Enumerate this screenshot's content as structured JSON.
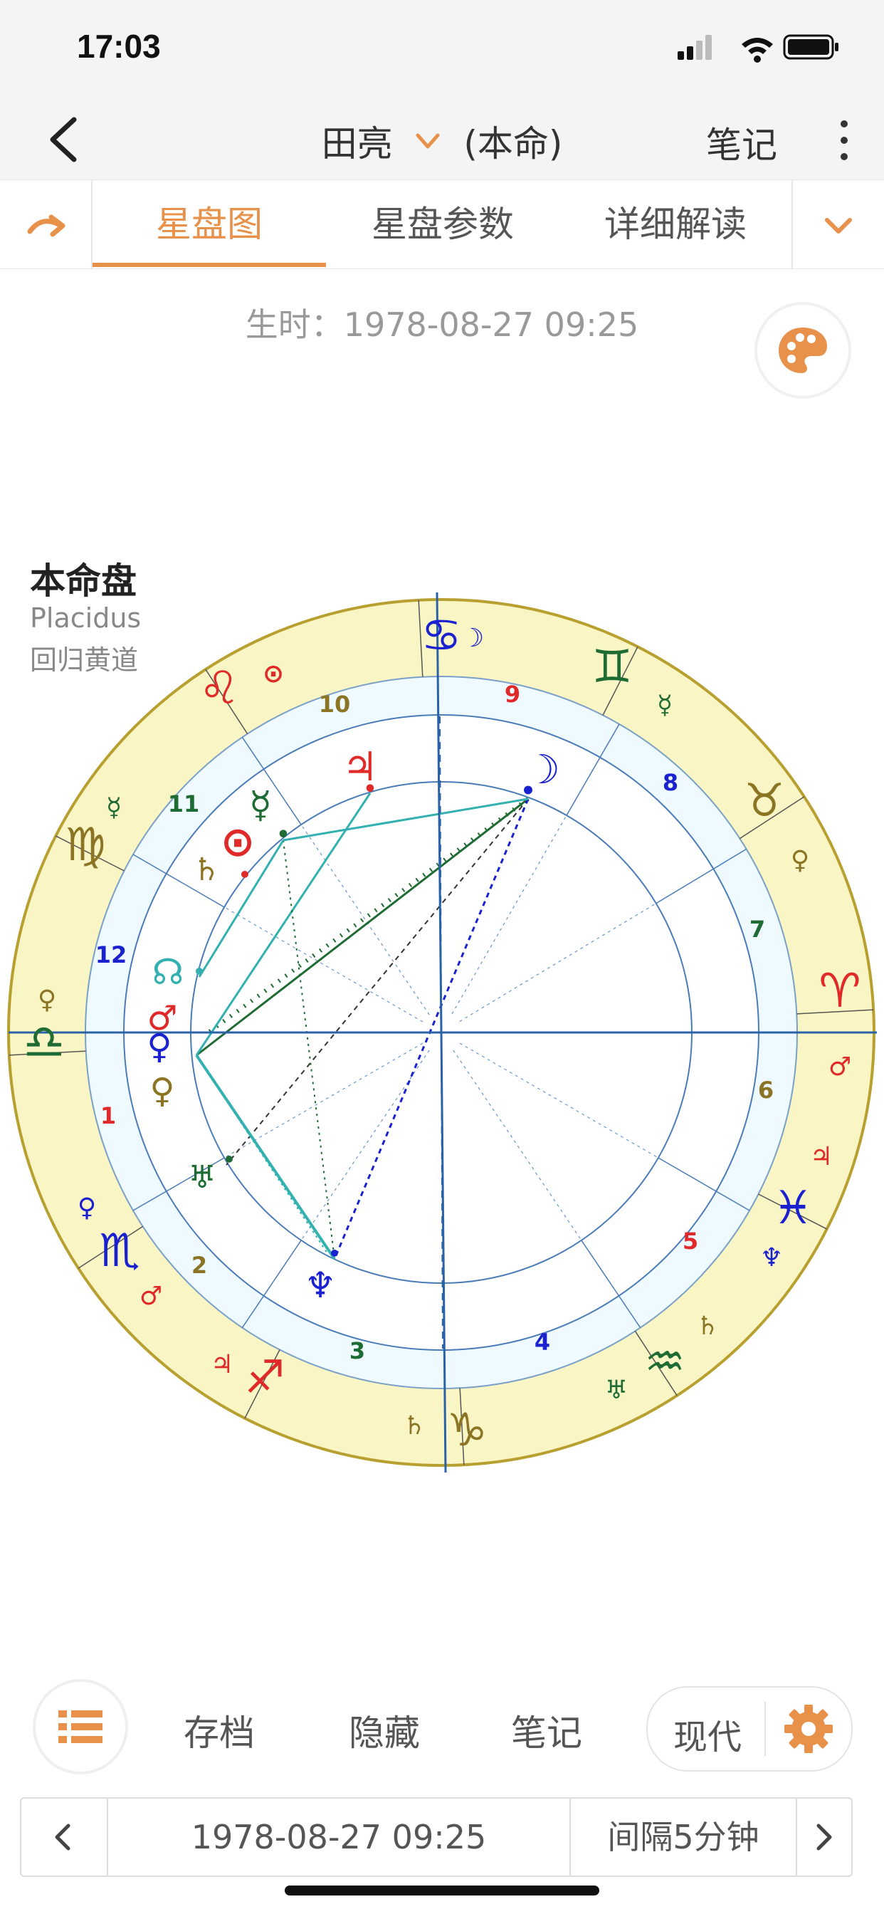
{
  "status": {
    "time": "17:03"
  },
  "header": {
    "name": "田亮",
    "type": "(本命)",
    "notes": "笔记"
  },
  "tabs": [
    {
      "label": "星盘图",
      "active": true
    },
    {
      "label": "星盘参数",
      "active": false
    },
    {
      "label": "详细解读",
      "active": false
    }
  ],
  "birth_time": "生时：1978-08-27 09:25",
  "chart": {
    "title": "本命盘",
    "house_system": "Placidus",
    "zodiac": "回归黄道",
    "houses": [
      "1",
      "2",
      "3",
      "4",
      "5",
      "6",
      "7",
      "8",
      "9",
      "10",
      "11",
      "12"
    ]
  },
  "bottom": {
    "archive": "存档",
    "hide": "隐藏",
    "notes": "笔记",
    "mode": "现代"
  },
  "datebar": {
    "date": "1978-08-27 09:25",
    "interval": "间隔5分钟"
  },
  "colors": {
    "accent": "#e8914a",
    "wheel_outer": "#faf5c4",
    "wheel_inner": "#eefaff",
    "fire": "#e02a2a",
    "earth": "#1e6b33",
    "air": "#8b7424",
    "water": "#1a22cf"
  }
}
